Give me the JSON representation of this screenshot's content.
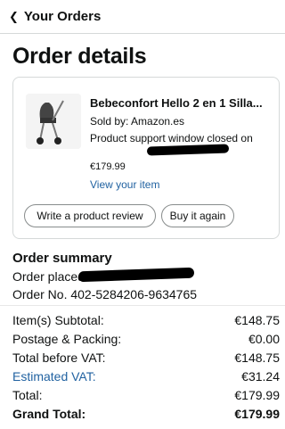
{
  "header": {
    "back_label": "Your Orders"
  },
  "page_title": "Order details",
  "item": {
    "title": "Bebeconfort Hello 2 en 1 Silla...",
    "sold_by": "Sold by: Amazon.es",
    "support_text": "Product support window closed on",
    "price": "€179.99",
    "view_link": "View your item",
    "review_button": "Write a product review",
    "buy_again_button": "Buy it again"
  },
  "summary": {
    "title": "Order summary",
    "order_placed": "Order placed",
    "order_number": "Order No. 402-5284206-9634765",
    "rows": [
      {
        "label": "Item(s) Subtotal:",
        "value": "€148.75"
      },
      {
        "label": "Postage & Packing:",
        "value": "€0.00"
      },
      {
        "label": "Total before VAT:",
        "value": "€148.75"
      },
      {
        "label": "Estimated VAT:",
        "value": "€31.24"
      },
      {
        "label": "Total:",
        "value": "€179.99"
      },
      {
        "label": "Grand Total:",
        "value": "€179.99"
      }
    ]
  },
  "colors": {
    "link": "#2162a1",
    "text": "#0f1111",
    "border": "#d5d9d9"
  }
}
